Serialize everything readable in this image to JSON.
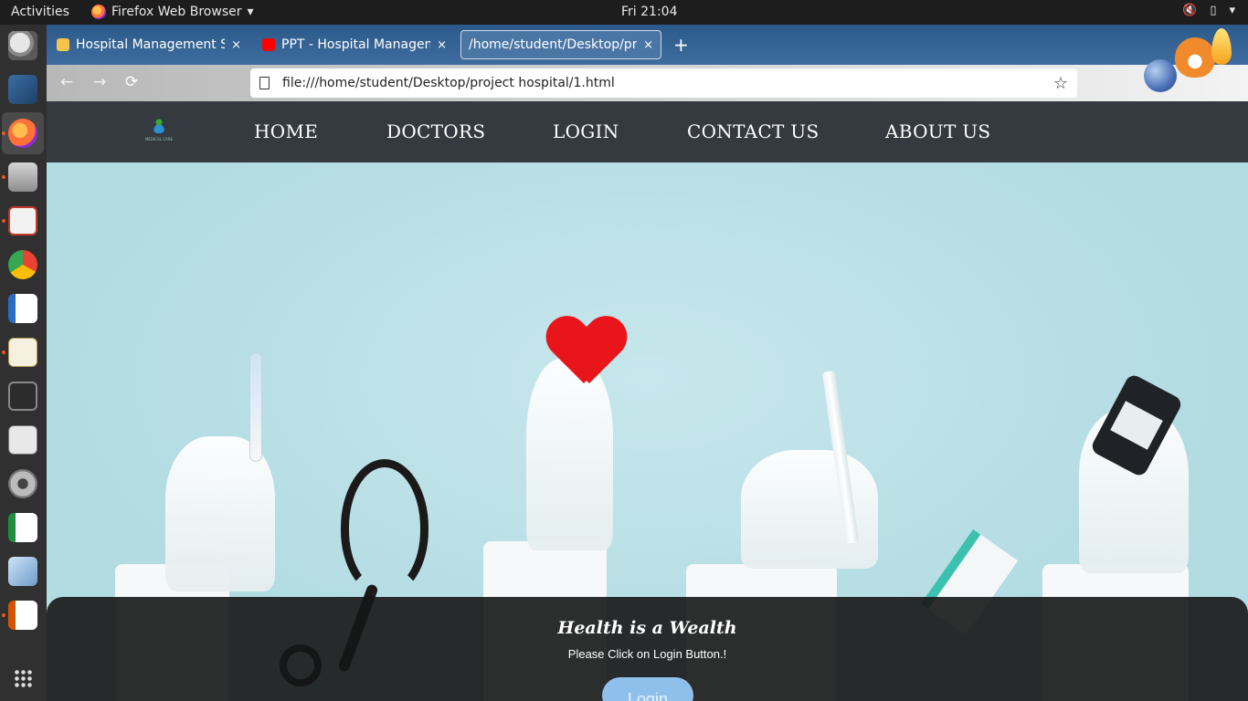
{
  "topbar": {
    "activities": "Activities",
    "app_name": "Firefox Web Browser",
    "clock": "Fri 21:04"
  },
  "browser": {
    "tabs": [
      {
        "title": "Hospital Management Sy",
        "close": "×"
      },
      {
        "title": "PPT - Hospital Manageme",
        "close": "×"
      },
      {
        "title": "/home/student/Desktop/pro",
        "close": "×"
      }
    ],
    "new_tab": "+",
    "url": "file:///home/student/Desktop/project hospital/1.html",
    "back": "←",
    "forward": "→",
    "reload": "⟳",
    "bookmark": "☆"
  },
  "site": {
    "nav": [
      "HOME",
      "DOCTORS",
      "LOGIN",
      "CONTACT US",
      "ABOUT US"
    ],
    "logo_text": "MEDICAL CARE",
    "caption_title": "Health is a Wealth",
    "caption_text": "Please Click on Login Button.!",
    "login_label": "Login"
  },
  "colors": {
    "site_nav_bg": "#343a40",
    "hero_bg": "#b9e0e6",
    "login_button": "#8fc0ec"
  },
  "icons": {
    "dock": [
      "magnifier-icon",
      "vpn-dolphin-icon",
      "firefox-icon",
      "files-icon",
      "pdf-viewer-icon",
      "chrome-icon",
      "writer-icon",
      "text-editor-icon",
      "terminal-icon",
      "texmaker-icon",
      "settings-tools-icon",
      "calc-icon",
      "virtualbox-icon",
      "impress-icon",
      "app-grid-icon"
    ]
  }
}
